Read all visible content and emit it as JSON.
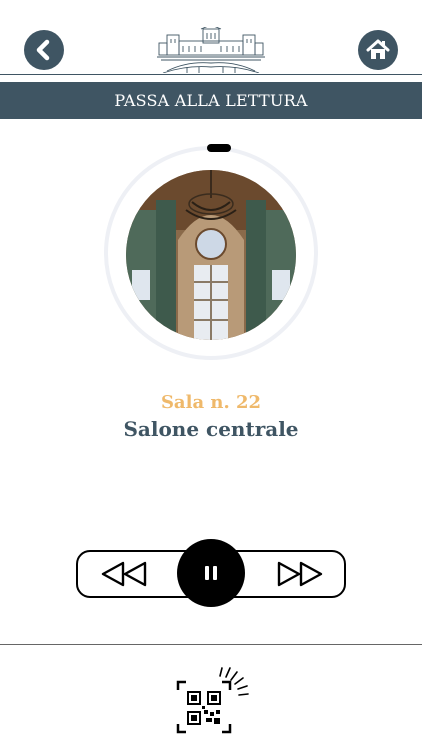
{
  "header": {
    "back_icon": "chevron-left-icon",
    "home_icon": "home-icon",
    "logo": "castle-logo"
  },
  "banner": {
    "label": "PASSA ALLA LETTURA"
  },
  "room": {
    "number_label": "Sala n. 22",
    "name": "Salone centrale"
  },
  "player": {
    "rewind_icon": "rewind-icon",
    "pause_icon": "pause-icon",
    "forward_icon": "fast-forward-icon",
    "progress": 0.02
  },
  "footer": {
    "qr_icon": "qr-scan-icon"
  },
  "colors": {
    "primary": "#3f5563",
    "accent": "#efb96b",
    "ring": "#eef0f5"
  }
}
